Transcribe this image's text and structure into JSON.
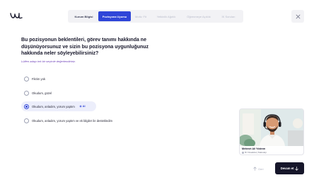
{
  "app": {
    "logo_icon": "brand-logo-icon",
    "accent_color": "#2f46d8"
  },
  "steps": [
    {
      "label": "Kurum Bilgisi",
      "state": "done"
    },
    {
      "label": "Pozisyona Uyumu",
      "state": "active"
    },
    {
      "label": "Motiv. Fit",
      "state": "todo"
    },
    {
      "label": "Yetkinlik Ağırlık",
      "state": "todo"
    },
    {
      "label": "Öğrenmeye Açıklık",
      "state": "todo"
    },
    {
      "label": "İK Soruları",
      "state": "todo"
    }
  ],
  "close_icon": "close-icon",
  "question": {
    "text": "Bu pozisyonun beklentileri, görev tanımı hakkında ne düşünüyorsunuz ve sizin bu pozisyona uygunluğunuz hakkında neler söyleyebilirsiniz?",
    "hint": "Lütfen adayı tek bir seçimle değerlendiriniz."
  },
  "options": [
    {
      "label": "Fikrim yok",
      "selected": false
    },
    {
      "label": "Okudum, güzel",
      "selected": false
    },
    {
      "label": "Okudum, anladım, yorum yaptım",
      "selected": true,
      "badge": "AI"
    },
    {
      "label": "Okudum, anladım, yorum yaptım ve ek bilgiler ile destekledim",
      "selected": false
    }
  ],
  "interviewer": {
    "name": "Mehmet Ali Yıldırım",
    "role": "İK Yöneticisi | Teknoloji"
  },
  "navigation": {
    "back_label": "Geri",
    "next_label": "Devam et"
  }
}
